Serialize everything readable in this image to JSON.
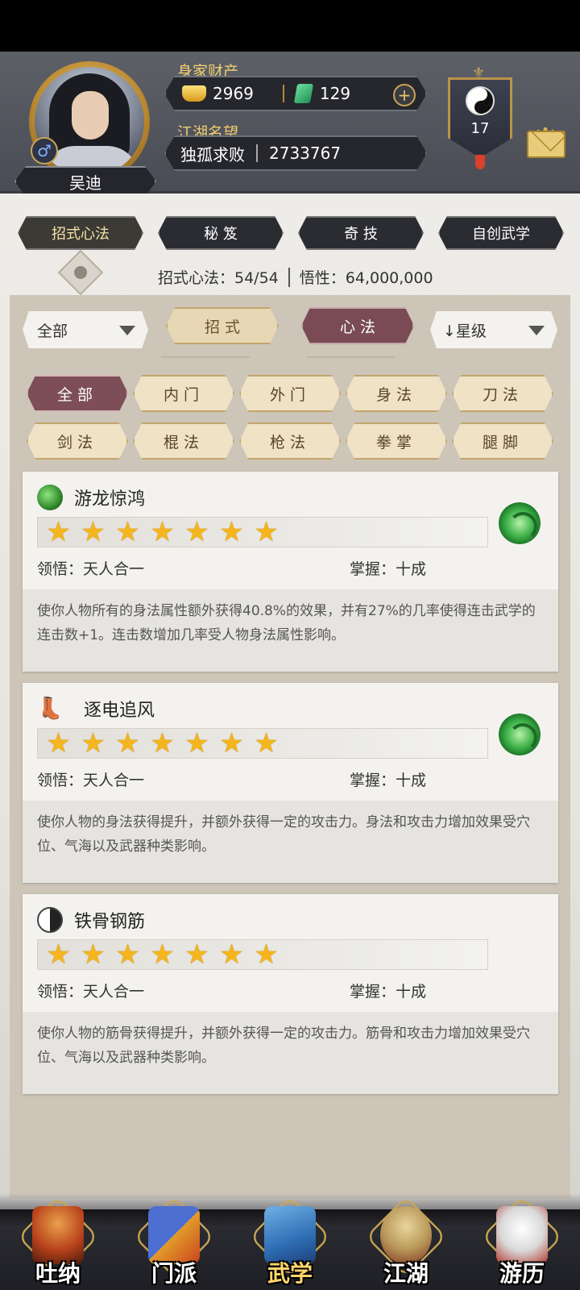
{
  "player": {
    "name": "吴迪",
    "gender_symbol": "♂",
    "wealth_label": "身家财产",
    "gold": "2969",
    "jade": "129",
    "reputation_label": "江湖名望",
    "title": "独孤求败",
    "reputation": "2733767",
    "level": "17"
  },
  "tabs": [
    "招式心法",
    "秘 笈",
    "奇 技",
    "自创武学"
  ],
  "active_tab": 0,
  "stats": {
    "moves_label": "招式心法：54/54",
    "insight_label": "悟性：64,000,000"
  },
  "filters": {
    "scope": "全部",
    "type_moves": "招 式",
    "type_mind": "心 法",
    "sort": "↓星级"
  },
  "categories": [
    "全部",
    "内门",
    "外门",
    "身法",
    "刀法",
    "剑法",
    "棍法",
    "枪法",
    "拳掌",
    "腿脚"
  ],
  "active_category": 0,
  "skills": [
    {
      "name": "游龙惊鸿",
      "icon": "green-orb-icon",
      "stars": 7,
      "comprehension": "领悟：天人合一",
      "mastery": "掌握：十成",
      "desc": "使你人物所有的身法属性额外获得40.8%的效果，并有27%的几率使得连击武学的连击数+1。连击数增加几率受人物身法属性影响。"
    },
    {
      "name": "逐电追风",
      "icon": "boot-icon",
      "stars": 7,
      "comprehension": "领悟：天人合一",
      "mastery": "掌握：十成",
      "desc": "使你人物的身法获得提升，并额外获得一定的攻击力。身法和攻击力增加效果受穴位、气海以及武器种类影响。"
    },
    {
      "name": "铁骨钢筋",
      "icon": "yinyang-icon",
      "stars": 7,
      "comprehension": "领悟：天人合一",
      "mastery": "掌握：十成",
      "desc": "使你人物的筋骨获得提升，并额外获得一定的攻击力。筋骨和攻击力增加效果受穴位、气海以及武器种类影响。"
    }
  ],
  "nav": [
    "吐纳",
    "门派",
    "武学",
    "江湖",
    "游历"
  ],
  "active_nav": 2,
  "colors": {
    "accent_gold": "#f0cf6e",
    "active_tab": "#7a4b55",
    "star": "#f4b51d"
  }
}
